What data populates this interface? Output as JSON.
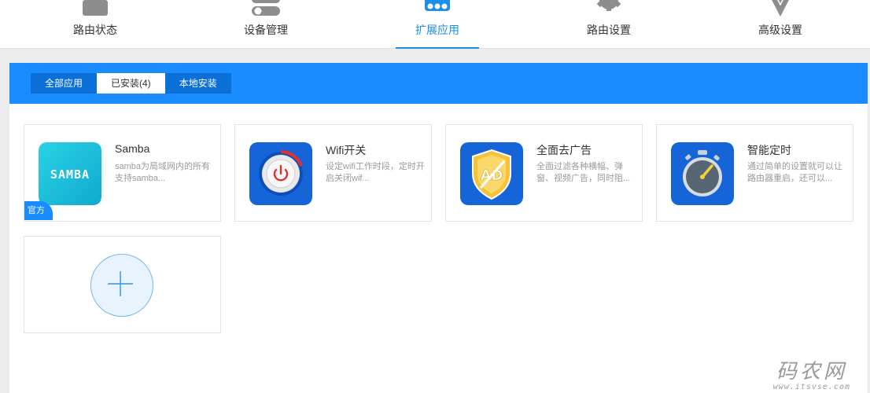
{
  "nav": {
    "items": [
      {
        "label": "路由状态",
        "icon": "router-status-icon"
      },
      {
        "label": "设备管理",
        "icon": "device-toggle-icon"
      },
      {
        "label": "扩展应用",
        "icon": "store-icon",
        "active": true
      },
      {
        "label": "路由设置",
        "icon": "gear-icon"
      },
      {
        "label": "高级设置",
        "icon": "diamond-icon"
      }
    ],
    "active_color": "#1a8ee8"
  },
  "tabs": [
    {
      "label": "全部应用"
    },
    {
      "label": "已安装(4)",
      "active": true
    },
    {
      "label": "本地安装"
    }
  ],
  "apps": [
    {
      "name": "Samba",
      "desc": "samba为局域网内的所有支持samba...",
      "icon": "samba-logo-icon",
      "icon_text": "SAMBA",
      "badge": "官方"
    },
    {
      "name": "Wifi开关",
      "desc": "设定wifi工作时段，定时开启关闭wif...",
      "icon": "power-button-icon"
    },
    {
      "name": "全面去广告",
      "desc": "全面过滤各种横幅、弹窗、视频广告，同时阻...",
      "icon": "ad-shield-icon",
      "icon_text": "AD"
    },
    {
      "name": "智能定时",
      "desc": "通过简单的设置就可以让路由器重启，还可以...",
      "icon": "stopwatch-icon"
    }
  ],
  "add_card": {
    "icon": "plus-icon"
  },
  "watermark": {
    "main": "码农网",
    "url": "www.itsvse.com"
  },
  "colors": {
    "header_blue": "#1a8cff",
    "tab_bar": "#0a6fd6",
    "badge": "#1a8cff"
  }
}
